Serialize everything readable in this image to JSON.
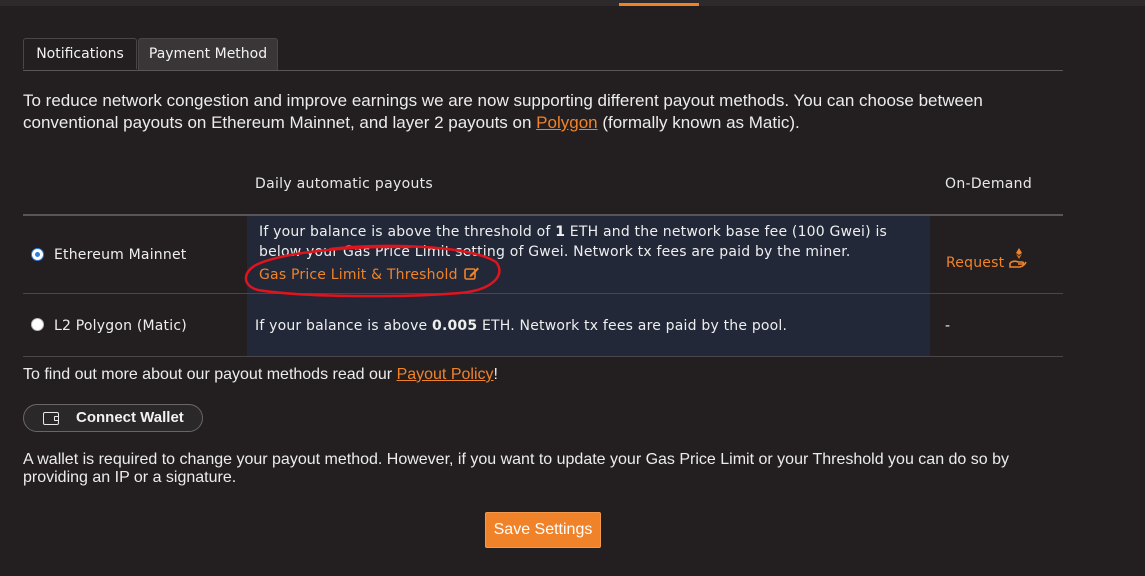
{
  "tabs": [
    {
      "label": "Notifications",
      "active": false
    },
    {
      "label": "Payment Method",
      "active": true
    }
  ],
  "intro": {
    "text_before": "To reduce network congestion and improve earnings we are now supporting different payout methods. You can choose between conventional payouts on Ethereum Mainnet, and layer 2 payouts on ",
    "link": "Polygon",
    "text_after": " (formally known as Matic)."
  },
  "table": {
    "headers": {
      "daily": "Daily automatic payouts",
      "on_demand": "On-Demand"
    },
    "rows": [
      {
        "name": "Ethereum Mainnet",
        "selected": true,
        "desc_part1": "If your balance is above the threshold of ",
        "threshold": "1",
        "desc_part2": " ETH and the network base fee (100 Gwei) is below your Gas Price Limit setting of Gwei. Network tx fees are paid by the miner.",
        "settings_link": "Gas Price Limit & Threshold",
        "on_demand": "Request"
      },
      {
        "name": "L2 Polygon (Matic)",
        "selected": false,
        "desc_part1": "If your balance is above ",
        "threshold": "0.005",
        "desc_part2": " ETH. Network tx fees are paid by the pool.",
        "on_demand": "-"
      }
    ]
  },
  "policy": {
    "text_before": "To find out more about our payout methods read our ",
    "link": "Payout Policy",
    "text_after": "!"
  },
  "connect_wallet": {
    "label": "Connect Wallet",
    "icon": "wallet-icon"
  },
  "note": "A wallet is required to change your payout method. However, if you want to update your Gas Price Limit or your Threshold you can do so by providing an IP or a signature.",
  "save_button": "Save Settings",
  "colors": {
    "accent": "#f0832a",
    "background": "#231f20",
    "panel": "#222838",
    "annotation": "#e0141c"
  }
}
